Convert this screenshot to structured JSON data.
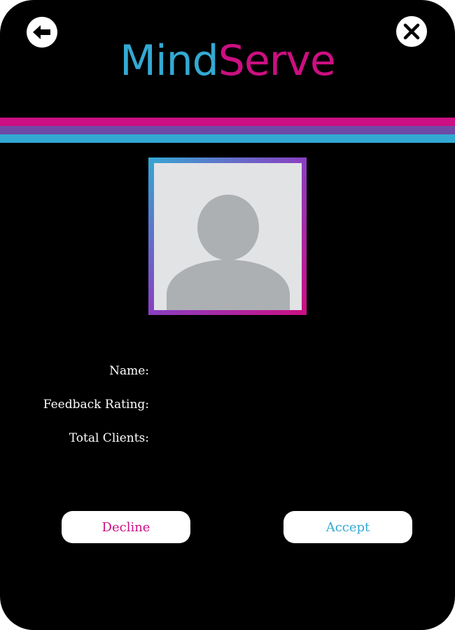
{
  "header": {
    "back_icon": "arrow-left-icon",
    "close_icon": "close-x-icon",
    "logo_part1": "Mind",
    "logo_part2": "Serve"
  },
  "colors": {
    "blue": "#33a9d3",
    "magenta": "#cc0f82",
    "purple": "#6e4aa6",
    "background": "#000000"
  },
  "profile": {
    "avatar_icon": "user-placeholder-icon",
    "fields": [
      {
        "label": "Name:",
        "value": ""
      },
      {
        "label": "Feedback Rating:",
        "value": ""
      },
      {
        "label": "Total Clients:",
        "value": ""
      }
    ]
  },
  "actions": {
    "decline_label": "Decline",
    "accept_label": "Accept"
  }
}
